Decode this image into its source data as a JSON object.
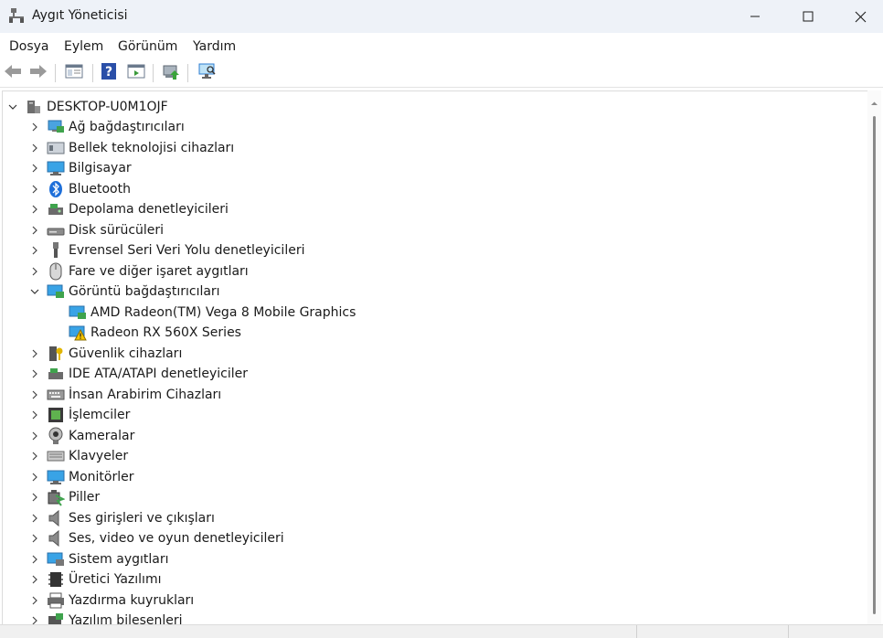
{
  "window": {
    "title": "Aygıt Yöneticisi",
    "icon": "device-manager-icon"
  },
  "caption": {
    "minimize_icon": "minimize-icon",
    "maximize_icon": "maximize-icon",
    "close_icon": "close-icon"
  },
  "menu": [
    "Dosya",
    "Eylem",
    "Görünüm",
    "Yardım"
  ],
  "toolbar": [
    "back-arrow-icon",
    "forward-arrow-icon",
    "properties-window-icon",
    "help-icon",
    "action-pane-icon",
    "update-driver-icon",
    "monitor-scan-icon"
  ],
  "tree": {
    "root": "DESKTOP-U0M1OJF",
    "categories": [
      {
        "label": "Ağ bağdaştırıcıları",
        "icon": "network-adapter-icon",
        "expanded": false
      },
      {
        "label": "Bellek teknolojisi cihazları",
        "icon": "memory-card-icon",
        "expanded": false
      },
      {
        "label": "Bilgisayar",
        "icon": "computer-icon",
        "expanded": false
      },
      {
        "label": "Bluetooth",
        "icon": "bluetooth-icon",
        "expanded": false
      },
      {
        "label": "Depolama denetleyicileri",
        "icon": "storage-controller-icon",
        "expanded": false
      },
      {
        "label": "Disk sürücüleri",
        "icon": "disk-drive-icon",
        "expanded": false
      },
      {
        "label": "Evrensel Seri Veri Yolu denetleyicileri",
        "icon": "usb-icon",
        "expanded": false
      },
      {
        "label": "Fare ve diğer işaret aygıtları",
        "icon": "mouse-icon",
        "expanded": false
      },
      {
        "label": "Görüntü bağdaştırıcıları",
        "icon": "display-adapter-icon",
        "expanded": true,
        "children": [
          {
            "label": "AMD Radeon(TM) Vega 8 Mobile Graphics",
            "icon": "display-adapter-icon",
            "warning": false
          },
          {
            "label": "Radeon RX 560X Series",
            "icon": "display-adapter-warning-icon",
            "warning": true
          }
        ]
      },
      {
        "label": "Güvenlik cihazları",
        "icon": "security-key-icon",
        "expanded": false
      },
      {
        "label": "IDE ATA/ATAPI denetleyiciler",
        "icon": "ide-controller-icon",
        "expanded": false
      },
      {
        "label": "İnsan Arabirim Cihazları",
        "icon": "hid-keyboard-icon",
        "expanded": false
      },
      {
        "label": "İşlemciler",
        "icon": "processor-icon",
        "expanded": false
      },
      {
        "label": "Kameralar",
        "icon": "camera-icon",
        "expanded": false
      },
      {
        "label": "Klavyeler",
        "icon": "keyboard-icon",
        "expanded": false
      },
      {
        "label": "Monitörler",
        "icon": "monitor-icon",
        "expanded": false
      },
      {
        "label": "Piller",
        "icon": "battery-icon",
        "expanded": false
      },
      {
        "label": "Ses girişleri ve çıkışları",
        "icon": "speaker-icon",
        "expanded": false
      },
      {
        "label": "Ses, video ve oyun denetleyicileri",
        "icon": "speaker-icon",
        "expanded": false
      },
      {
        "label": "Sistem aygıtları",
        "icon": "system-devices-icon",
        "expanded": false
      },
      {
        "label": "Üretici Yazılımı",
        "icon": "firmware-icon",
        "expanded": false
      },
      {
        "label": "Yazdırma kuyrukları",
        "icon": "printer-icon",
        "expanded": false
      },
      {
        "label": "Yazılım bileşenleri",
        "icon": "software-component-icon",
        "expanded": false
      }
    ]
  },
  "colors": {
    "titlebar": "#eef2f8",
    "accent_blue": "#2d7dd2",
    "warning": "#f5c400"
  }
}
